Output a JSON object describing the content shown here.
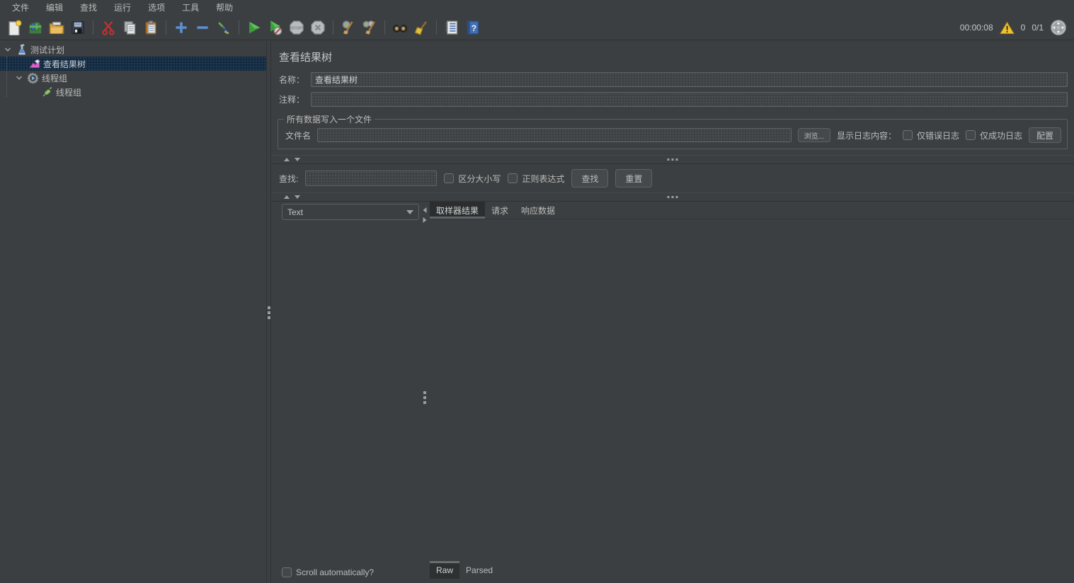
{
  "menubar": {
    "items": [
      "文件",
      "编辑",
      "查找",
      "运行",
      "选项",
      "工具",
      "帮助"
    ]
  },
  "toolbar": {
    "icons": [
      "new-file-icon",
      "templates-icon",
      "open-folder-icon",
      "save-icon",
      "cut-icon",
      "copy-icon",
      "paste-icon",
      "expand-all-icon",
      "collapse-all-icon",
      "toggle-icon",
      "start-icon",
      "start-no-pauses-icon",
      "stop-icon",
      "shutdown-icon",
      "clear-icon",
      "clear-all-icon",
      "search-icon",
      "clear-search-icon",
      "function-helper-icon",
      "help-icon"
    ],
    "timer": "00:00:08",
    "error_count": "0",
    "thread_status": "0/1"
  },
  "tree": {
    "items": [
      {
        "label": "测试计划",
        "icon": "test-plan-icon",
        "expanded": true
      },
      {
        "label": "查看结果树",
        "icon": "results-tree-icon",
        "selected": true
      },
      {
        "label": "线程组",
        "icon": "thread-group-icon",
        "expanded": true
      },
      {
        "label": "线程组",
        "icon": "sampler-icon"
      }
    ]
  },
  "panel": {
    "title": "查看结果树",
    "name_label": "名称：",
    "name_value": "查看结果树",
    "comment_label": "注释：",
    "comment_value": "",
    "file_group": {
      "legend": "所有数据写入一个文件",
      "filename_label": "文件名",
      "filename_value": "",
      "browse_button": "浏览...",
      "log_display_label": "显示日志内容：",
      "errors_only_label": "仅错误日志",
      "success_only_label": "仅成功日志",
      "config_button": "配置"
    },
    "search": {
      "label": "查找:",
      "value": "",
      "case_sensitive_label": "区分大小写",
      "regex_label": "正则表达式",
      "find_button": "查找",
      "reset_button": "重置"
    },
    "renderer": {
      "selected": "Text"
    },
    "tabs": [
      {
        "label": "取样器结果",
        "selected": true
      },
      {
        "label": "请求",
        "selected": false
      },
      {
        "label": "响应数据",
        "selected": false
      }
    ],
    "scroll_label": "Scroll automatically?",
    "bottom_tabs": [
      {
        "label": "Raw",
        "selected": true
      },
      {
        "label": "Parsed",
        "selected": false
      }
    ]
  },
  "colors": {
    "bg": "#3c3f41",
    "selection": "#142a3f",
    "warning": "#f2c230",
    "accent_blue": "#5d8fd0"
  }
}
